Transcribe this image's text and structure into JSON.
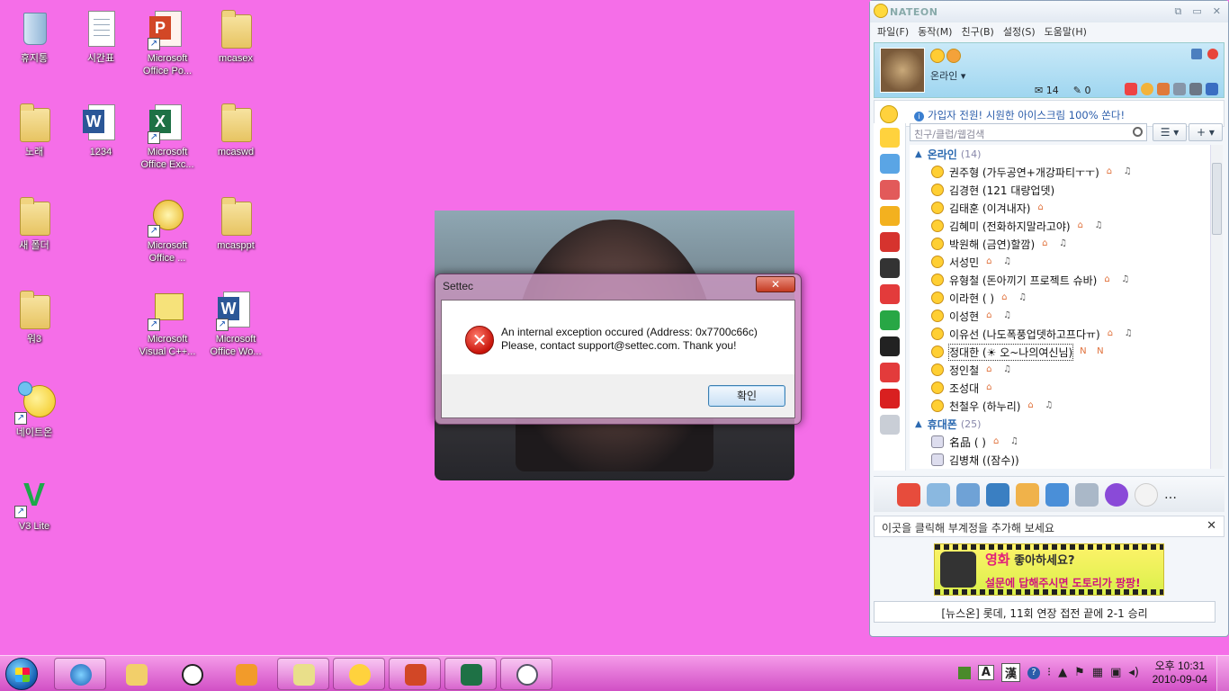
{
  "desktop": {
    "icons": [
      {
        "label": "휴지통"
      },
      {
        "label": "시간표"
      },
      {
        "label": "Microsoft Office Po..."
      },
      {
        "label": "mcasex"
      },
      {
        "label": "노래"
      },
      {
        "label": "1234"
      },
      {
        "label": "Microsoft Office Exc..."
      },
      {
        "label": "mcaswd"
      },
      {
        "label": "새 폴더"
      },
      {
        "label": "Microsoft Office ..."
      },
      {
        "label": "mcasppt"
      },
      {
        "label": "워3"
      },
      {
        "label": "Microsoft Visual C++..."
      },
      {
        "label": "Microsoft Office Wo..."
      },
      {
        "label": "네이트온"
      },
      {
        "label": "V3 Lite"
      }
    ]
  },
  "dialog": {
    "title": "Settec",
    "close_label": "✕",
    "message_line1": "An internal exception occured (Address: 0x7700c66c)",
    "message_line2": "Please, contact support@settec.com. Thank you!",
    "ok_label": "확인"
  },
  "nateon": {
    "logo": "NATEON",
    "menu": [
      "파일(F)",
      "동작(M)",
      "친구(B)",
      "설정(S)",
      "도움말(H)"
    ],
    "status": "온라인 ▾",
    "mail_count": "14",
    "note_count": "0",
    "notice": "가입자 전원! 시원한 아이스크림 100% 쏜다!",
    "search_placeholder": "친구/클럽/웹검색",
    "list_btn": "☰ ▾",
    "add_btn": "+ ▾",
    "groups": [
      {
        "name": "온라인",
        "count": "(14)"
      },
      {
        "name": "휴대폰",
        "count": "(25)"
      }
    ],
    "online": [
      {
        "name": "권주형 (가두공연+개강파티ㅜㅜ)"
      },
      {
        "name": "김경현 (121 대량업뎃)"
      },
      {
        "name": "김태훈 (이겨내자)"
      },
      {
        "name": "김혜미 (전화하지말라고야)"
      },
      {
        "name": "박원해 (금연)할깜)"
      },
      {
        "name": "서성민"
      },
      {
        "name": "유형철 (돈아끼기 프로젝트 슈바)"
      },
      {
        "name": "이라현 ( )"
      },
      {
        "name": "이성현"
      },
      {
        "name": "이유선 (나도폭풍업뎃하고프다ㅠ)"
      },
      {
        "name": "정대한 (☀ 오~나의여신님)"
      },
      {
        "name": "정인철"
      },
      {
        "name": "조성대"
      },
      {
        "name": "천철우 (하누리)"
      }
    ],
    "mobile": [
      {
        "name": "名品 ( )"
      },
      {
        "name": "김병채 ((잠수))"
      }
    ],
    "sub_account": "이곳을 클릭해 부계정을 추가해 보세요",
    "ad_line1_red": "영화",
    "ad_line1": "좋아하세요?",
    "ad_line2": "설문에 답해주시면 도토리가 팡팡!",
    "news": "[뉴스온] 롯데, 11회 연장 접전 끝에 2-1 승리"
  },
  "taskbar": {
    "ime_a": "A",
    "ime_han": "漢",
    "clock_time": "오후 10:31",
    "clock_date": "2010-09-04"
  }
}
